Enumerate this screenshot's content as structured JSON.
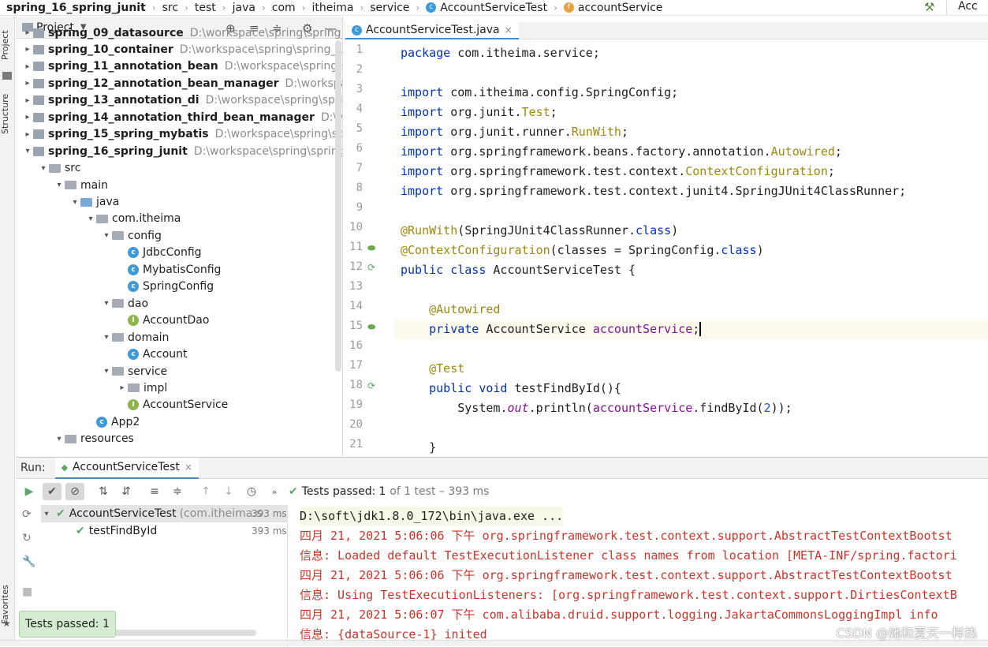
{
  "breadcrumb": {
    "items": [
      "spring_16_spring_junit",
      "src",
      "test",
      "java",
      "com",
      "itheima",
      "service",
      "AccountServiceTest",
      "accountService"
    ],
    "right_label": "Acc"
  },
  "left_strip": {
    "project_tab": "Project",
    "structure_tab": "Structure",
    "favorites_tab": "Favorites"
  },
  "project_panel": {
    "title": "Project",
    "tree": [
      {
        "label": "spring_09_datasource",
        "path": "D:\\workspace\\spring\\spring_09_",
        "bold": true,
        "arrow": "▸"
      },
      {
        "label": "spring_10_container",
        "path": "D:\\workspace\\spring\\spring_10_co",
        "bold": true,
        "arrow": "▸"
      },
      {
        "label": "spring_11_annotation_bean",
        "path": "D:\\workspace\\spring\\sprin",
        "bold": true,
        "arrow": "▸"
      },
      {
        "label": "spring_12_annotation_bean_manager",
        "path": "D:\\workspace\\sp",
        "bold": true,
        "arrow": "▸"
      },
      {
        "label": "spring_13_annotation_di",
        "path": "D:\\workspace\\spring\\spring_1",
        "bold": true,
        "arrow": "▸"
      },
      {
        "label": "spring_14_annotation_third_bean_manager",
        "path": "D:\\works",
        "bold": true,
        "arrow": "▸"
      },
      {
        "label": "spring_15_spring_mybatis",
        "path": "D:\\workspace\\spring\\spring",
        "bold": true,
        "arrow": "▸"
      },
      {
        "label": "spring_16_spring_junit",
        "path": "D:\\workspace\\spring\\spring_16_",
        "bold": true,
        "arrow": "▾"
      },
      {
        "label": "src",
        "arrow": "▾"
      },
      {
        "label": "main",
        "arrow": "▾"
      },
      {
        "label": "java",
        "arrow": "▾"
      },
      {
        "label": "com.itheima",
        "arrow": "▾"
      },
      {
        "label": "config",
        "arrow": "▾"
      },
      {
        "label": "JdbcConfig"
      },
      {
        "label": "MybatisConfig"
      },
      {
        "label": "SpringConfig"
      },
      {
        "label": "dao",
        "arrow": "▾"
      },
      {
        "label": "AccountDao"
      },
      {
        "label": "domain",
        "arrow": "▾"
      },
      {
        "label": "Account"
      },
      {
        "label": "service",
        "arrow": "▾"
      },
      {
        "label": "impl",
        "arrow": "▸"
      },
      {
        "label": "AccountService"
      },
      {
        "label": "App2"
      },
      {
        "label": "resources",
        "arrow": "▾"
      }
    ]
  },
  "editor": {
    "tab_label": "AccountServiceTest.java",
    "line_numbers": [
      "1",
      "2",
      "3",
      "4",
      "5",
      "6",
      "7",
      "8",
      "9",
      "10",
      "11",
      "12",
      "13",
      "14",
      "15",
      "16",
      "17",
      "18",
      "19",
      "20",
      "21"
    ]
  },
  "run_panel": {
    "run_label": "Run:",
    "config_tab": "AccountServiceTest",
    "status_prefix": "Tests passed:",
    "status_count": "1",
    "status_suffix": "of 1 test – 393 ms",
    "tree": {
      "root_label": "AccountServiceTest",
      "root_pkg": "(com.itheima.s",
      "root_time": "393 ms",
      "child_label": "testFindById",
      "child_time": "393 ms"
    },
    "console": [
      "D:\\soft\\jdk1.8.0_172\\bin\\java.exe ...",
      "四月 21, 2021 5:06:06 下午 org.springframework.test.context.support.AbstractTestContextBootst",
      "信息: Loaded default TestExecutionListener class names from location [META-INF/spring.factori",
      "四月 21, 2021 5:06:06 下午 org.springframework.test.context.support.AbstractTestContextBootst",
      "信息: Using TestExecutionListeners: [org.springframework.test.context.support.DirtiesContextB",
      "四月 21, 2021 5:06:07 下午 com.alibaba.druid.support.logging.JakartaCommonsLoggingImpl info",
      "信息: {dataSource-1} inited"
    ]
  },
  "toast": {
    "label": "Tests passed: 1"
  },
  "watermark": "CSDN @她和夏天一样热",
  "colors": {
    "accent": "#4a88c7",
    "keyword": "#0033b3",
    "annotation": "#9e880d",
    "field": "#871094",
    "console_red": "#c8352a",
    "pass_green": "#59a869"
  }
}
